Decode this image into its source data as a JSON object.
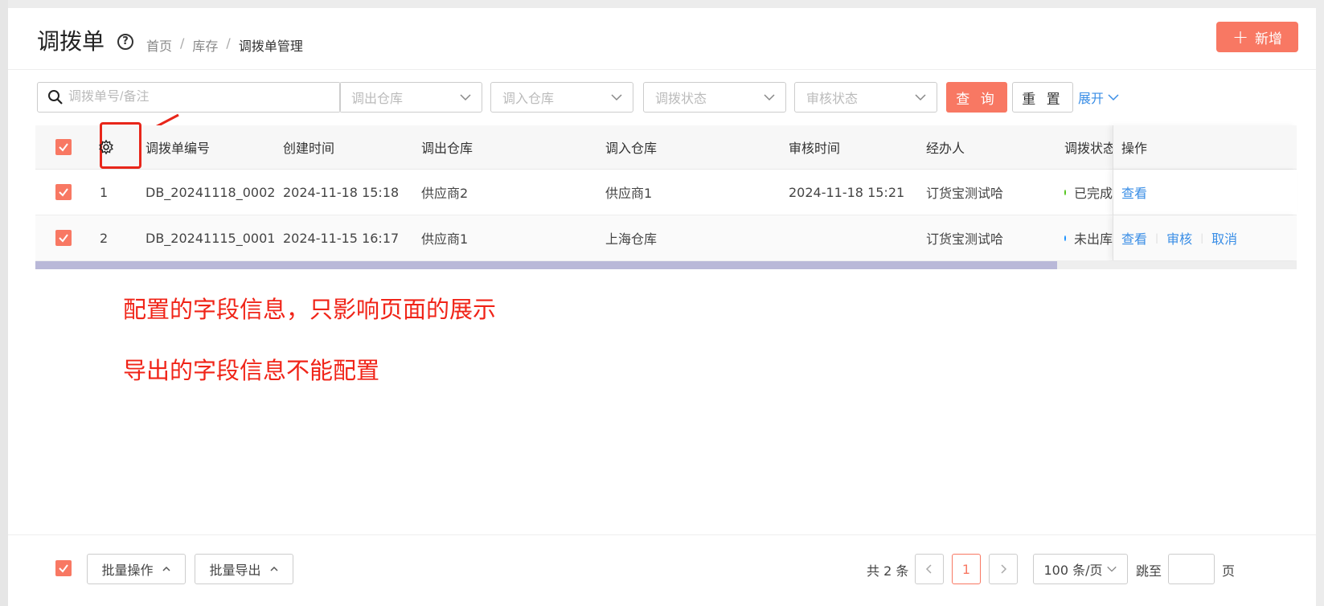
{
  "header": {
    "title": "调拨单",
    "breadcrumb": [
      "首页",
      "库存",
      "调拨单管理"
    ],
    "add_label": "新增"
  },
  "filters": {
    "search_placeholder": "调拨单号/备注",
    "out_warehouse": "调出仓库",
    "in_warehouse": "调入仓库",
    "transfer_status": "调拨状态",
    "audit_status": "审核状态",
    "query_label": "查 询",
    "reset_label": "重 置",
    "expand_label": "展开"
  },
  "table": {
    "columns": [
      "调拨单编号",
      "创建时间",
      "调出仓库",
      "调入仓库",
      "审核时间",
      "经办人",
      "调拨状态",
      "操作"
    ],
    "rows": [
      {
        "index": "1",
        "code": "DB_20241118_0002",
        "created": "2024-11-18 15:18",
        "out": "供应商2",
        "in": "供应商1",
        "audit_time": "2024-11-18 15:21",
        "handler": "订货宝测试哈",
        "status": "已完成",
        "status_color": "#52c41a",
        "ops": [
          "查看"
        ]
      },
      {
        "index": "2",
        "code": "DB_20241115_0001",
        "created": "2024-11-15 16:17",
        "out": "供应商1",
        "in": "上海仓库",
        "audit_time": "",
        "handler": "订货宝测试哈",
        "status": "未出库",
        "status_color": "#1890ff",
        "ops": [
          "查看",
          "审核",
          "取消"
        ]
      }
    ],
    "scroll_fraction": 0.81
  },
  "annotations": {
    "line1": "配置的字段信息，只影响页面的展示",
    "line2": "导出的字段信息不能配置"
  },
  "footer": {
    "batch_ops": "批量操作",
    "batch_export": "批量导出",
    "total": "共 2 条",
    "current_page": "1",
    "page_size": "100 条/页",
    "jump_label": "跳至",
    "page_unit": "页"
  },
  "colors": {
    "accent": "#f87863",
    "link": "#3a8ee6",
    "annotation": "#f02418"
  }
}
